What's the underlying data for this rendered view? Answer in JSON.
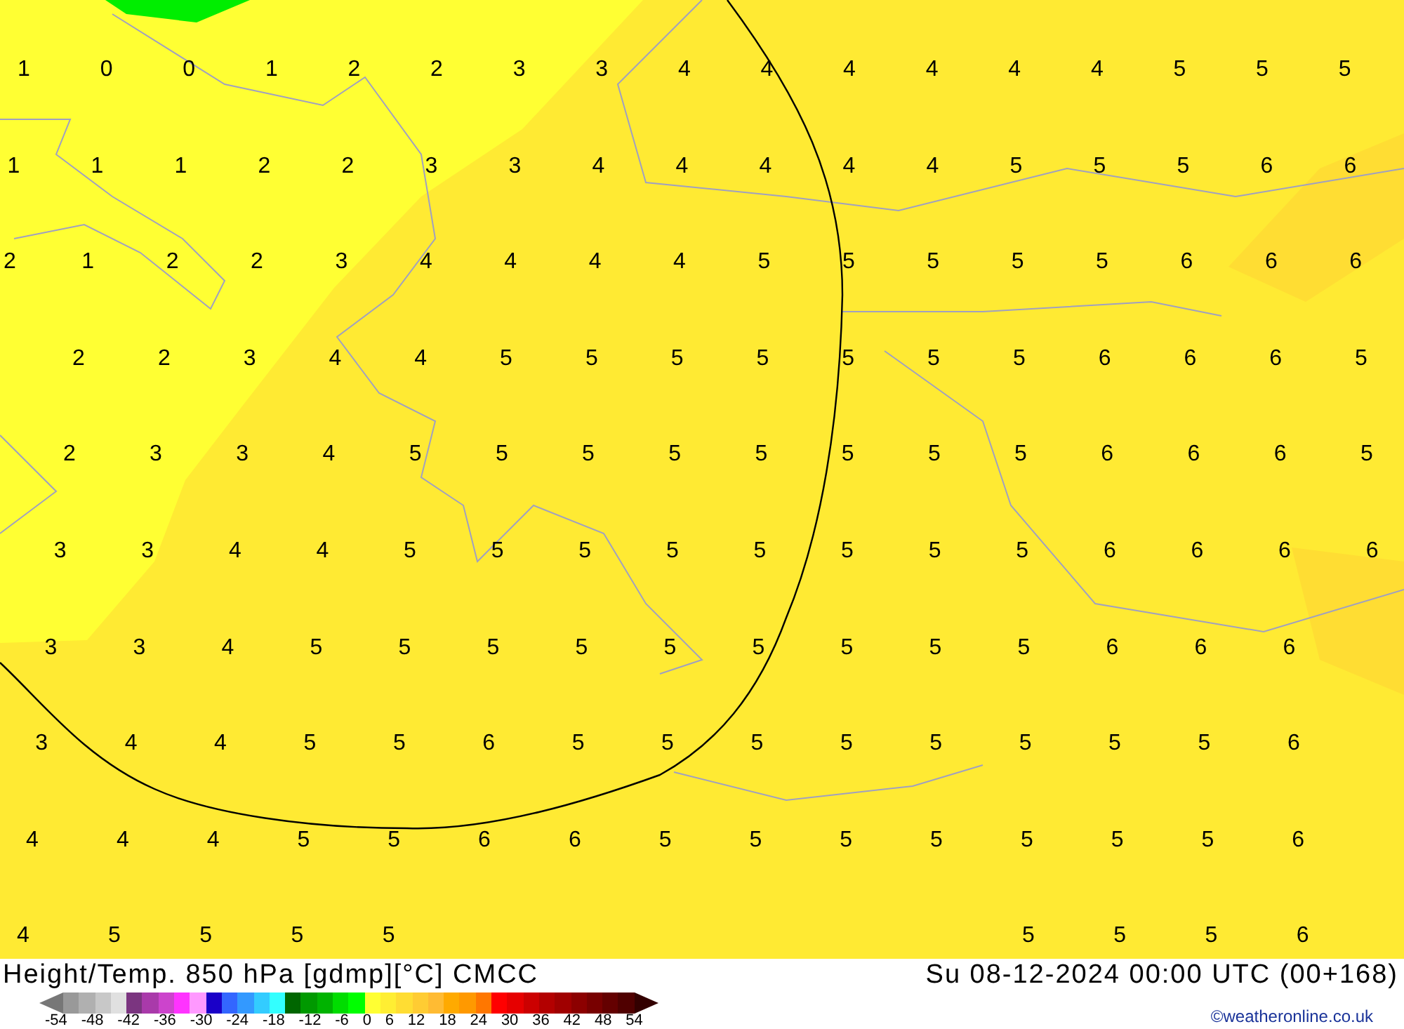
{
  "map": {
    "temperature_rows": [
      [
        "1",
        "0",
        "0",
        "1",
        "2",
        "2",
        "3",
        "3",
        "4",
        "4",
        "4",
        "4",
        "4",
        "4",
        "5",
        "5",
        "5"
      ],
      [
        "1",
        "1",
        "1",
        "2",
        "2",
        "3",
        "3",
        "4",
        "4",
        "4",
        "4",
        "4",
        "5",
        "5",
        "5",
        "6",
        "6"
      ],
      [
        "2",
        "1",
        "2",
        "2",
        "3",
        "4",
        "4",
        "4",
        "4",
        "5",
        "5",
        "5",
        "5",
        "5",
        "6",
        "6",
        "6"
      ],
      [
        "2",
        "2",
        "3",
        "4",
        "4",
        "5",
        "5",
        "5",
        "5",
        "5",
        "5",
        "5",
        "6",
        "6",
        "6",
        "5"
      ],
      [
        "2",
        "3",
        "3",
        "4",
        "5",
        "5",
        "5",
        "5",
        "5",
        "5",
        "5",
        "5",
        "6",
        "6",
        "6",
        "5"
      ],
      [
        "3",
        "3",
        "4",
        "4",
        "5",
        "5",
        "5",
        "5",
        "5",
        "5",
        "5",
        "5",
        "6",
        "6",
        "6",
        "6"
      ],
      [
        "3",
        "3",
        "4",
        "5",
        "5",
        "5",
        "5",
        "5",
        "5",
        "5",
        "5",
        "5",
        "6",
        "6",
        "6"
      ],
      [
        "3",
        "4",
        "4",
        "5",
        "5",
        "6",
        "5",
        "5",
        "5",
        "5",
        "5",
        "5",
        "5",
        "5",
        "6"
      ],
      [
        "4",
        "4",
        "4",
        "5",
        "5",
        "6",
        "6",
        "5",
        "5",
        "5",
        "5",
        "5",
        "5",
        "5",
        "6"
      ],
      [
        "4",
        "5",
        "5",
        "5",
        "5",
        null,
        null,
        null,
        null,
        null,
        null,
        "5",
        "5",
        "5",
        "6"
      ]
    ]
  },
  "footer": {
    "title": "Height/Temp. 850 hPa [gdmp][°C] CMCC",
    "valid_time": "Su 08-12-2024 00:00 UTC (00+168)",
    "legend": {
      "colors": [
        {
          "kind": "arrow",
          "color": "#777777"
        },
        {
          "kind": "band",
          "color": "#999999"
        },
        {
          "kind": "band",
          "color": "#b0b0b0"
        },
        {
          "kind": "band",
          "color": "#c8c8c8"
        },
        {
          "kind": "band",
          "color": "#e0e0e0"
        },
        {
          "kind": "band",
          "color": "#7b3580"
        },
        {
          "kind": "band",
          "color": "#a93aaa"
        },
        {
          "kind": "band",
          "color": "#cc44cc"
        },
        {
          "kind": "band",
          "color": "#ff33ff"
        },
        {
          "kind": "band",
          "color": "#ff99ff"
        },
        {
          "kind": "band",
          "color": "#1a00c8"
        },
        {
          "kind": "band",
          "color": "#3366ff"
        },
        {
          "kind": "band",
          "color": "#3399ff"
        },
        {
          "kind": "band",
          "color": "#33ccff"
        },
        {
          "kind": "band",
          "color": "#33ffff"
        },
        {
          "kind": "band",
          "color": "#006600"
        },
        {
          "kind": "band",
          "color": "#009900"
        },
        {
          "kind": "band",
          "color": "#00b300"
        },
        {
          "kind": "band",
          "color": "#00dd00"
        },
        {
          "kind": "band",
          "color": "#00ff00"
        },
        {
          "kind": "band",
          "color": "#ffff33"
        },
        {
          "kind": "band",
          "color": "#ffee33"
        },
        {
          "kind": "band",
          "color": "#ffdd33"
        },
        {
          "kind": "band",
          "color": "#ffcc33"
        },
        {
          "kind": "band",
          "color": "#ffbb33"
        },
        {
          "kind": "band",
          "color": "#ffaa00"
        },
        {
          "kind": "band",
          "color": "#ff9900"
        },
        {
          "kind": "band",
          "color": "#ff7700"
        },
        {
          "kind": "band",
          "color": "#ff0000"
        },
        {
          "kind": "band",
          "color": "#e60000"
        },
        {
          "kind": "band",
          "color": "#cc0000"
        },
        {
          "kind": "band",
          "color": "#b30000"
        },
        {
          "kind": "band",
          "color": "#a00000"
        },
        {
          "kind": "band",
          "color": "#8c0000"
        },
        {
          "kind": "band",
          "color": "#780000"
        },
        {
          "kind": "band",
          "color": "#640000"
        },
        {
          "kind": "band",
          "color": "#500000"
        },
        {
          "kind": "arrow",
          "color": "#330000"
        }
      ],
      "ticks": [
        "-54",
        "-48",
        "-42",
        "-36",
        "-30",
        "-24",
        "-18",
        "-12",
        "-6",
        "0",
        "6",
        "12",
        "18",
        "24",
        "30",
        "36",
        "42",
        "48",
        "54"
      ]
    },
    "credit": "©weatheronline.co.uk"
  }
}
